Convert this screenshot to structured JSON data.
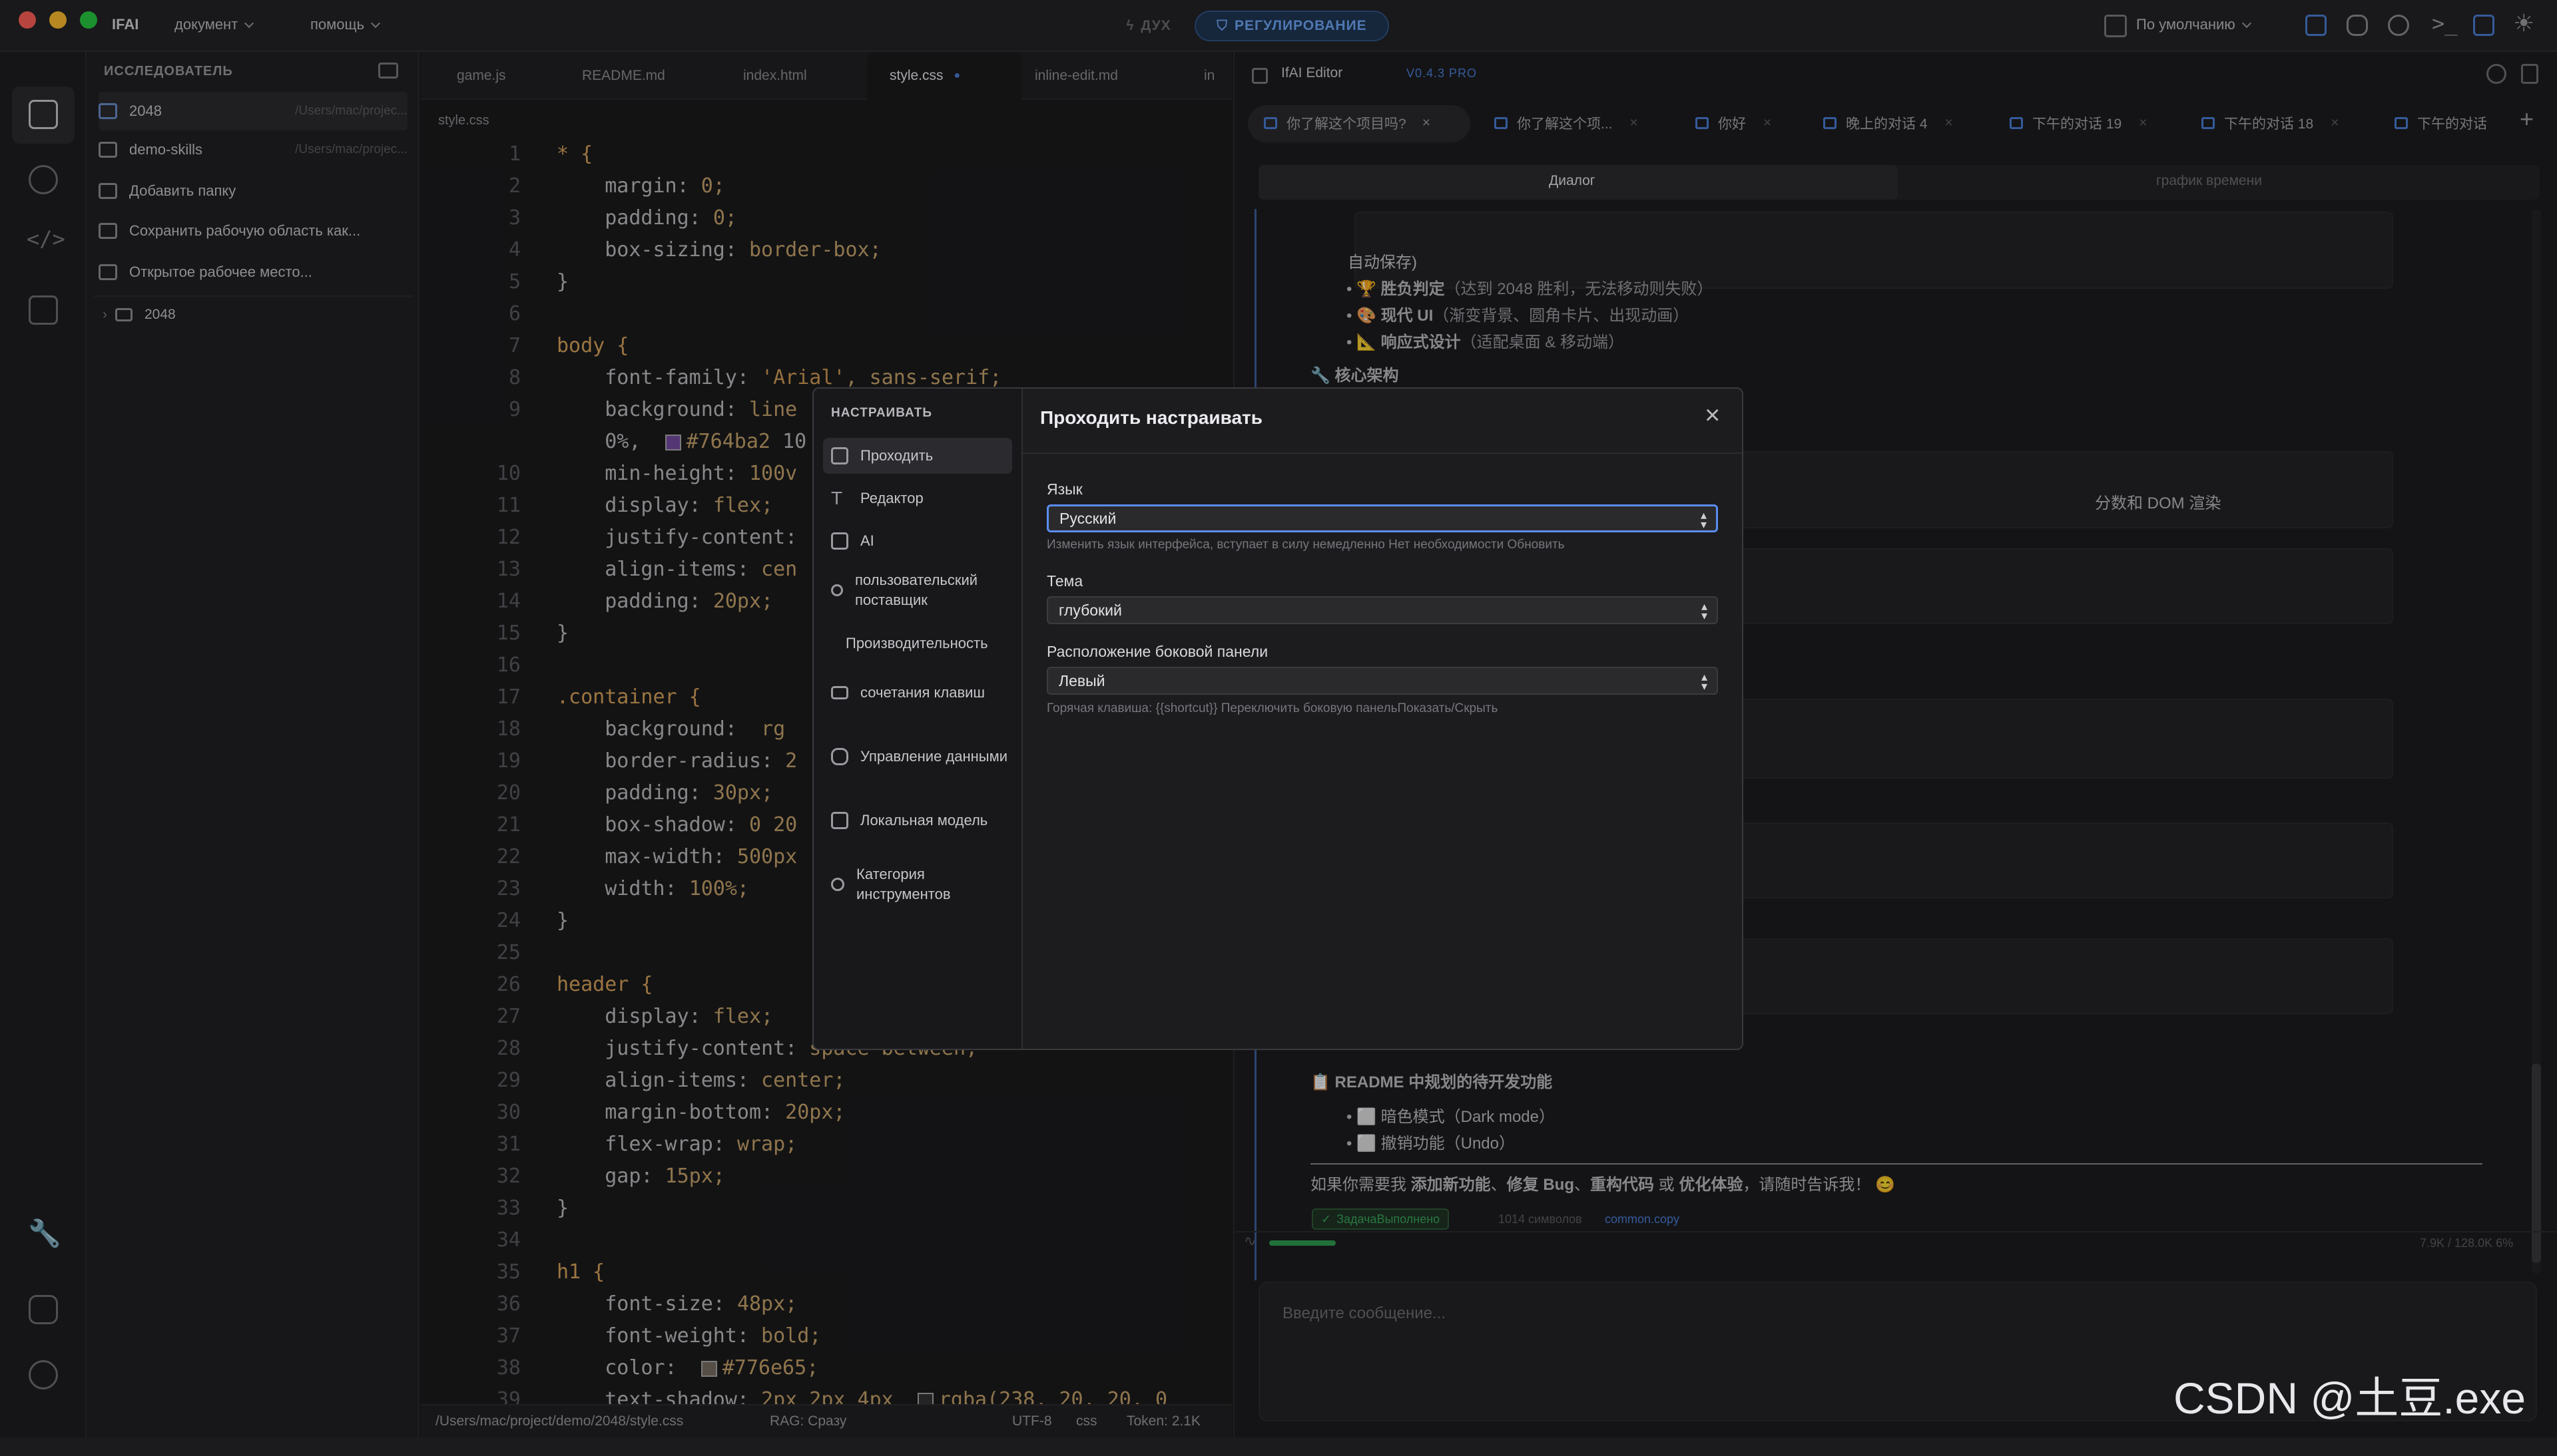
{
  "titlebar": {
    "app": "IFAI",
    "menu_document": "документ",
    "menu_help": "помощь",
    "mode_spirit": "ДУХ",
    "mode_regulation": "РЕГУЛИРОВАНИЕ",
    "layout_default": "По умолчанию"
  },
  "explorer": {
    "header": "ИССЛЕДОВАТЕЛЬ",
    "workspaces": [
      {
        "name": "2048",
        "path": "/Users/mac/projec..."
      },
      {
        "name": "demo-skills",
        "path": "/Users/mac/projec..."
      }
    ],
    "add_folder": "Добавить папку",
    "save_workspace": "Сохранить рабочую область как...",
    "open_workspace": "Открытое рабочее место...",
    "tree_root": "2048"
  },
  "editor": {
    "tabs": [
      "game.js",
      "README.md",
      "index.html",
      "style.css",
      "inline-edit.md",
      "in"
    ],
    "active_tab": "style.css",
    "breadcrumb": "style.css",
    "lines": [
      {
        "n": "1",
        "t": "* {"
      },
      {
        "n": "2",
        "t": "    margin: 0;"
      },
      {
        "n": "3",
        "t": "    padding: 0;"
      },
      {
        "n": "4",
        "t": "    box-sizing: border-box;"
      },
      {
        "n": "5",
        "t": "}"
      },
      {
        "n": "6",
        "t": ""
      },
      {
        "n": "7",
        "t": "body {"
      },
      {
        "n": "8",
        "t": "    font-family: 'Arial', sans-serif;"
      },
      {
        "n": "9",
        "t": "    background: line"
      },
      {
        "n": "",
        "t": "    0%,  #764ba2 10"
      },
      {
        "n": "10",
        "t": "    min-height: 100v"
      },
      {
        "n": "11",
        "t": "    display: flex;"
      },
      {
        "n": "12",
        "t": "    justify-content:"
      },
      {
        "n": "13",
        "t": "    align-items: cen"
      },
      {
        "n": "14",
        "t": "    padding: 20px;"
      },
      {
        "n": "15",
        "t": "}"
      },
      {
        "n": "16",
        "t": ""
      },
      {
        "n": "17",
        "t": ".container {"
      },
      {
        "n": "18",
        "t": "    background:  rg"
      },
      {
        "n": "19",
        "t": "    border-radius: 2"
      },
      {
        "n": "20",
        "t": "    padding: 30px;"
      },
      {
        "n": "21",
        "t": "    box-shadow: 0 20"
      },
      {
        "n": "22",
        "t": "    max-width: 500px"
      },
      {
        "n": "23",
        "t": "    width: 100%;"
      },
      {
        "n": "24",
        "t": "}"
      },
      {
        "n": "25",
        "t": ""
      },
      {
        "n": "26",
        "t": "header {"
      },
      {
        "n": "27",
        "t": "    display: flex;"
      },
      {
        "n": "28",
        "t": "    justify-content: space-between;"
      },
      {
        "n": "29",
        "t": "    align-items: center;"
      },
      {
        "n": "30",
        "t": "    margin-bottom: 20px;"
      },
      {
        "n": "31",
        "t": "    flex-wrap: wrap;"
      },
      {
        "n": "32",
        "t": "    gap: 15px;"
      },
      {
        "n": "33",
        "t": "}"
      },
      {
        "n": "34",
        "t": ""
      },
      {
        "n": "35",
        "t": "h1 {"
      },
      {
        "n": "36",
        "t": "    font-size: 48px;"
      },
      {
        "n": "37",
        "t": "    font-weight: bold;"
      },
      {
        "n": "38",
        "t": "    color:  #776e65;"
      },
      {
        "n": "39",
        "t": "    text-shadow: 2px 2px 4px  rgba(238, 20, 20, 0"
      }
    ],
    "status": {
      "path": "/Users/mac/project/demo/2048/style.css",
      "rag": "RAG: Сразу",
      "encoding": "UTF-8",
      "lang": "css",
      "tokens": "Token: 2.1K"
    }
  },
  "panel": {
    "title": "IfAI Editor",
    "version": "V0.4.3 PRO",
    "chat_tabs": [
      "你了解这个项目吗?",
      "你了解这个项...",
      "你好",
      "晚上的对话 4",
      "下午的对话 19",
      "下午的对话 18",
      "下午的对话"
    ],
    "view_tabs": [
      "Диалог",
      "график времени"
    ],
    "chat": {
      "autosave": "自动保存)",
      "bullet1_bold": "🏆 胜负判定",
      "bullet1_rest": "（达到 2048 胜利，无法移动则失败）",
      "bullet2_bold": "🎨 现代 UI",
      "bullet2_rest": "（渐变背景、圆角卡片、出现动画）",
      "bullet3_bold": "📐 响应式设计",
      "bullet3_rest": "（适配桌面 & 移动端）",
      "arch": "🔧 核心架构",
      "dom_note": "分数和 DOM 渲染",
      "readme_title": "📋 README 中规划的待开发功能",
      "todo1": "⬜ 暗色模式（Dark mode）",
      "todo2": "⬜ 撤销功能（Undo）",
      "closing_a": "如果你需要我 ",
      "closing_b1": "添加新功能",
      "closing_c": "、",
      "closing_b2": "修复 Bug",
      "closing_b3": "重构代码",
      "closing_d": " 或 ",
      "closing_b4": "优化体验",
      "closing_e": "，请随时告诉我！ 😊",
      "task_done": "ЗадачаВыполнено",
      "chars": "1014 символов",
      "copy": "common.copy"
    },
    "context": "7.9K / 128.0K 6%",
    "input_placeholder": "Введите сообщение..."
  },
  "modal": {
    "side_header": "НАСТРАИВАТЬ",
    "side_items": [
      "Проходить",
      "Редактор",
      "AI",
      "пользовательский поставщик",
      "Производительность",
      "сочетания клавиш",
      "Управление данными",
      "Локальная модель",
      "Категория инструментов"
    ],
    "title": "Проходить настраивать",
    "language_label": "Язык",
    "language_value": "Русский",
    "language_hint": "Изменить язык интерфейса, вступает в силу немедленно Нет необходимости Обновить",
    "theme_label": "Тема",
    "theme_value": "глубокий",
    "sidebar_label": "Расположение боковой панели",
    "sidebar_value": "Левый",
    "sidebar_hint": "Горячая клавиша: {{shortcut}} Переключить боковую панельПоказать/Скрыть"
  },
  "watermark": "CSDN @土豆.exe",
  "colors": {
    "accent": "#4a7fd6",
    "focus": "#5b8ef0",
    "selector": "#d7a25b",
    "ok": "#3aa65a"
  }
}
